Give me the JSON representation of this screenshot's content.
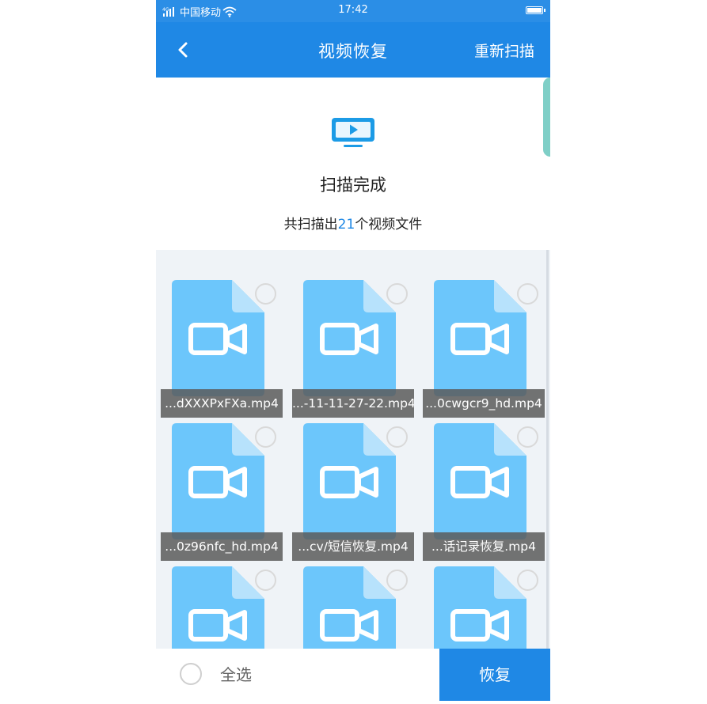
{
  "status_bar": {
    "carrier": "中国移动",
    "time": "17:42"
  },
  "nav": {
    "title": "视频恢复",
    "action": "重新扫描"
  },
  "scan": {
    "title": "扫描完成",
    "summary_prefix": "共扫描出",
    "count": "21",
    "summary_suffix": "个视频文件"
  },
  "files": [
    {
      "name": "...dXXXPxFXa.mp4"
    },
    {
      "name": "...-11-11-27-22.mp4"
    },
    {
      "name": "...0cwgcr9_hd.mp4"
    },
    {
      "name": "...0z96nfc_hd.mp4"
    },
    {
      "name": "...cv/短信恢复.mp4"
    },
    {
      "name": "...话记录恢复.mp4"
    },
    {
      "name": ""
    },
    {
      "name": ""
    },
    {
      "name": ""
    }
  ],
  "bottom": {
    "select_all": "全选",
    "restore": "恢复"
  },
  "colors": {
    "primary": "#1f88e5",
    "file_icon": "#6cc6fb",
    "file_fold": "#b7e2fc",
    "grid_bg": "#eff3f7"
  },
  "icons": {
    "back": "chevron-left-icon",
    "tv": "video-monitor-icon",
    "file": "video-file-icon"
  }
}
